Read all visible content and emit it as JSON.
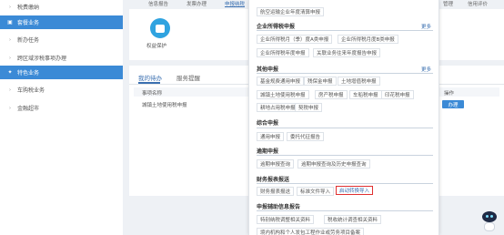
{
  "sidebar": {
    "items": [
      {
        "label": "税费缴纳",
        "icon": "chevron-right-icon",
        "active": false
      },
      {
        "label": "套餐业务",
        "icon": "package-icon",
        "active": true
      },
      {
        "label": "新办任务",
        "icon": "chevron-right-icon",
        "active": false
      },
      {
        "label": "跨区域涉税事项办理",
        "icon": "chevron-right-icon",
        "active": false
      },
      {
        "label": "特色业务",
        "icon": "star-icon",
        "active": true
      },
      {
        "label": "车购税业务",
        "icon": "chevron-right-icon",
        "active": false
      },
      {
        "label": "金融超市",
        "icon": "chevron-right-icon",
        "active": false
      }
    ]
  },
  "top_tabs": [
    "信息报告",
    "发票办理",
    "申报纳税",
    "管理",
    "信用评价"
  ],
  "service_card": {
    "label": "权益保护"
  },
  "tasks": {
    "tabs": [
      "我的待办",
      "服务提醒"
    ],
    "columns": [
      "事项名称",
      "操作"
    ],
    "rows": [
      {
        "name": "城镇土地使用税申报",
        "action": "办理"
      }
    ]
  },
  "menu": {
    "top_item": "航空运输企业年度清算申报",
    "sections": [
      {
        "title": "企业所得税申报",
        "more": "更多",
        "items": [
          "企业所得税月（季）度A类申报",
          "企业所得税月度B类申报",
          "企业所得税年度申报",
          "关联业务往来年度报告申报"
        ]
      },
      {
        "title": "其他申报",
        "more": "更多",
        "items": [
          "基金规费通用申报",
          "残保金申报",
          "土地增值税申报",
          "城镇土地使用税申报",
          "房产税申报",
          "车船税申报",
          "印花税申报",
          "耕地占用税申报",
          "契税申报"
        ]
      },
      {
        "title": "综合申报",
        "items": [
          "通用申报",
          "委托代征报告"
        ]
      },
      {
        "title": "逾期申报",
        "items": [
          "逾期申报查询",
          "逾期申报查询及历史申报查询"
        ]
      },
      {
        "title": "财务报表报送",
        "items": [
          "财务报表报送",
          "标准文件导入",
          "启动转换导入"
        ]
      },
      {
        "title": "申报辅助信息报告",
        "items": [
          "特别纳税调整相关资料",
          "税收统计调查相关资料",
          "境内机构和个人发包工程作业或劳务项目备案"
        ]
      }
    ],
    "highlighted_item": "启动转换导入"
  },
  "colors": {
    "primary": "#3b8ad6",
    "highlight_border": "#e03030",
    "link": "#3a6fb0"
  }
}
